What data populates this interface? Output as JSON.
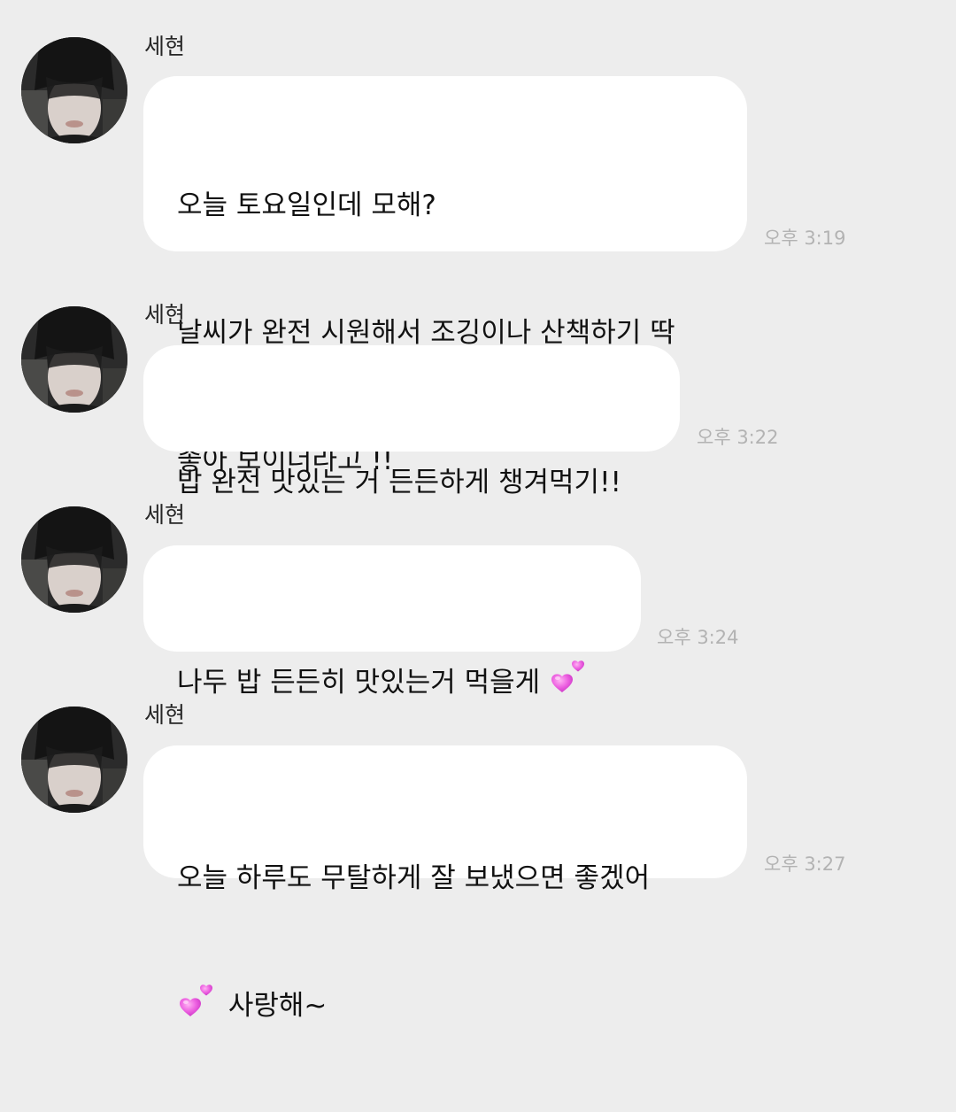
{
  "messages": [
    {
      "sender": "세현",
      "lines": [
        "        오늘 토요일인데 모해?",
        "날씨가 완전 시원해서 조깅이나 산책하기 딱",
        "좋아 보이더라고 !!"
      ],
      "time": "오후 3:19"
    },
    {
      "sender": "세현",
      "lines": [
        "밥 완전 맛있는 거 든든하게 챙겨먹기!!"
      ],
      "time": "오후 3:22"
    },
    {
      "sender": "세현",
      "lines": [
        "나두 밥 든든히 맛있는거 먹을게 "
      ],
      "emoji": "two-hearts-icon",
      "time": "오후 3:24"
    },
    {
      "sender": "세현",
      "lines": [
        "오늘 하루도 무탈하게 잘 보냈으면 좋겠어",
        " 사랑해~"
      ],
      "emoji": "two-hearts-icon",
      "time": "오후 3:27"
    }
  ],
  "colors": {
    "background": "#ededed",
    "bubble": "#ffffff",
    "timestamp": "#b3b3b3",
    "heart": "#e34fd6"
  }
}
